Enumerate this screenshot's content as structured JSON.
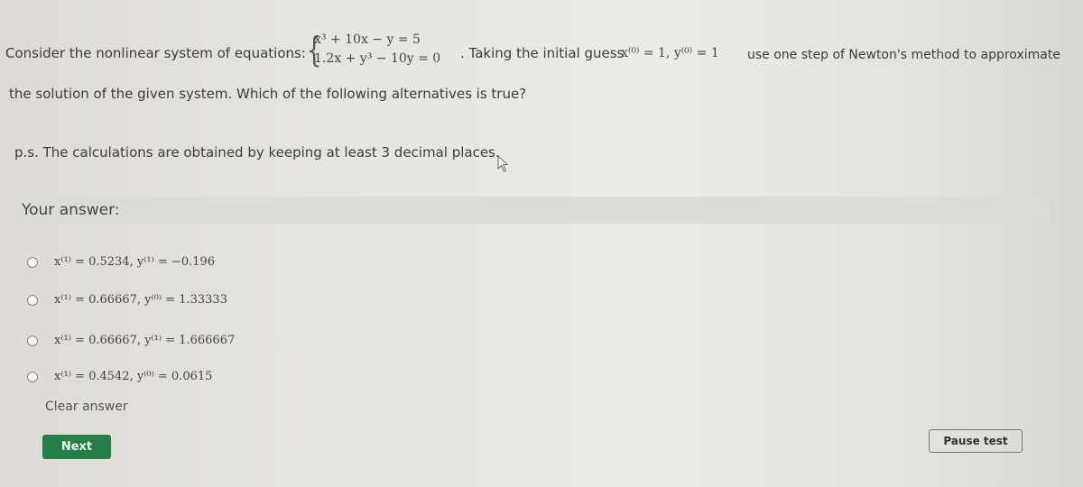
{
  "question": {
    "intro": "Consider the nonlinear system of equations:",
    "equations": [
      "x³ + 10x − y = 5",
      "1.2x + y³ − 10y = 0"
    ],
    "guess_prefix": ". Taking the initial guess",
    "guess": "x⁽⁰⁾ = 1, y⁽⁰⁾ = 1",
    "instruction": "use one step of Newton's method to approximate",
    "line2": "the solution of the given system. Which of the following alternatives is true?",
    "note": "p.s. The calculations are obtained by keeping at least 3 decimal places."
  },
  "answer": {
    "label": "Your answer:",
    "options": [
      {
        "text": "x⁽¹⁾ = 0.5234, y⁽¹⁾ = −0.196",
        "selected": false
      },
      {
        "text": "x⁽¹⁾ = 0.66667, y⁽⁰⁾ = 1.33333",
        "selected": false
      },
      {
        "text": "x⁽¹⁾ = 0.66667, y⁽¹⁾ = 1.666667",
        "selected": false
      },
      {
        "text": "x⁽¹⁾ = 0.4542, y⁽⁰⁾ = 0.0615",
        "selected": false
      }
    ],
    "clear_label": "Clear answer"
  },
  "buttons": {
    "next": "Next",
    "pause": "Pause test"
  },
  "colors": {
    "next_bg": "#237f47"
  }
}
